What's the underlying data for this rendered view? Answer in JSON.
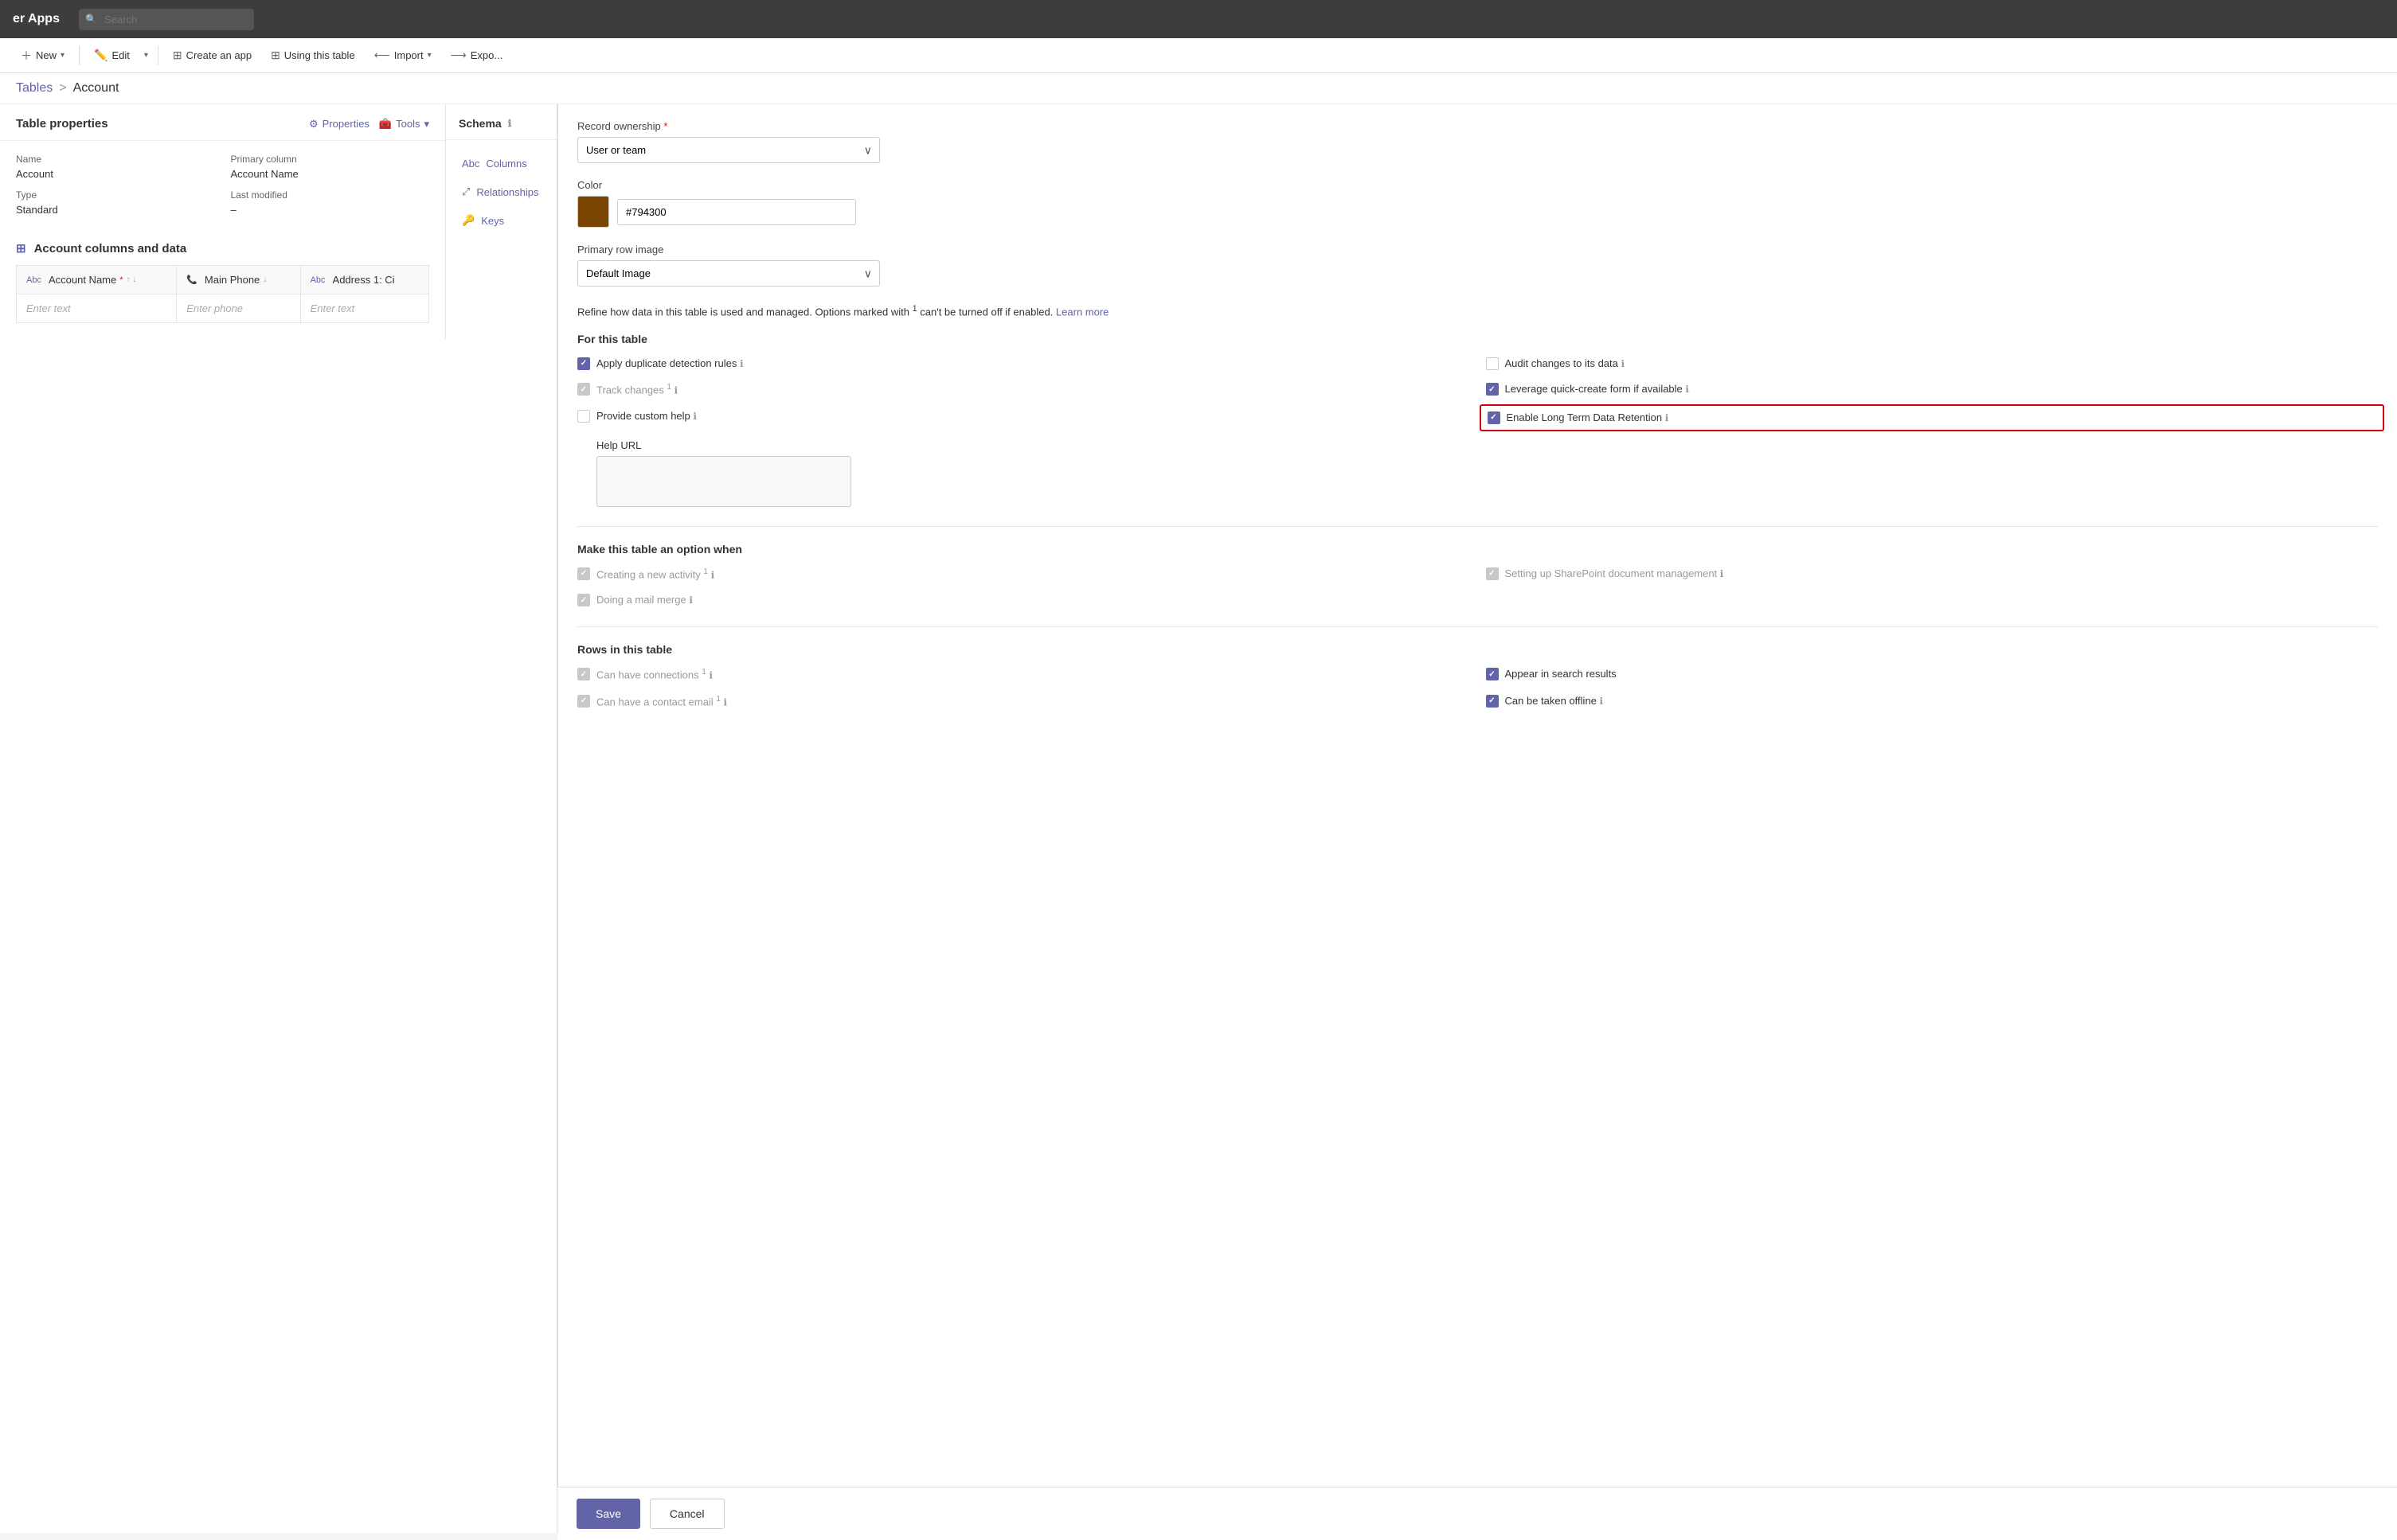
{
  "topbar": {
    "title": "er Apps",
    "search_placeholder": "Search"
  },
  "cmdbar": {
    "new_label": "New",
    "edit_label": "Edit",
    "create_app_label": "Create an app",
    "using_table_label": "Using this table",
    "import_label": "Import",
    "export_label": "Expo..."
  },
  "breadcrumb": {
    "parent": "Tables",
    "separator": ">",
    "current": "Account"
  },
  "table_properties": {
    "section_title": "Table properties",
    "properties_btn": "Properties",
    "tools_btn": "Tools",
    "name_label": "Name",
    "name_value": "Account",
    "primary_col_label": "Primary column",
    "primary_col_value": "Account Name",
    "type_label": "Type",
    "type_value": "Standard",
    "last_modified_label": "Last modified",
    "last_modified_value": "–"
  },
  "schema": {
    "title": "Schema",
    "columns": "Columns",
    "relationships": "Relationships",
    "keys": "Keys"
  },
  "columns_section": {
    "title": "Account columns and data",
    "columns": [
      {
        "label": "Account Name",
        "icon": "Abc",
        "required": true,
        "sort": true
      },
      {
        "label": "Main Phone",
        "icon": "phone"
      },
      {
        "label": "Address 1: Ci",
        "icon": "Abc"
      }
    ],
    "placeholder_text": "Enter text",
    "placeholder_phone": "Enter phone"
  },
  "right_panel": {
    "record_ownership_label": "Record ownership",
    "record_ownership_required": true,
    "record_ownership_value": "User or team",
    "color_label": "Color",
    "color_hex": "#794300",
    "color_swatch": "#794300",
    "primary_row_image_label": "Primary row image",
    "primary_row_image_value": "Default Image",
    "description": "Refine how data in this table is used and managed. Options marked with",
    "description_sup": "1",
    "description_2": "can't be turned off if enabled.",
    "learn_more": "Learn more",
    "for_this_table": {
      "title": "For this table",
      "options": [
        {
          "id": "apply_duplicate",
          "label": "Apply duplicate detection rules",
          "checked": true,
          "disabled": false,
          "info": true
        },
        {
          "id": "audit_changes",
          "label": "Audit changes to its data",
          "checked": false,
          "disabled": false,
          "info": true
        },
        {
          "id": "track_changes",
          "label": "Track changes",
          "checked": false,
          "disabled": true,
          "sup": true,
          "info": true
        },
        {
          "id": "leverage_quick",
          "label": "Leverage quick-create form if available",
          "checked": true,
          "disabled": false,
          "info": true
        },
        {
          "id": "provide_custom_help",
          "label": "Provide custom help",
          "checked": false,
          "disabled": false,
          "info": true
        },
        {
          "id": "enable_long_term",
          "label": "Enable Long Term Data Retention",
          "checked": true,
          "disabled": false,
          "info": true,
          "highlighted": true
        }
      ],
      "help_url_label": "Help URL"
    },
    "make_option": {
      "title": "Make this table an option when",
      "options": [
        {
          "id": "creating_activity",
          "label": "Creating a new activity",
          "checked": true,
          "disabled": true,
          "sup": true,
          "info": true
        },
        {
          "id": "sharepoint_doc",
          "label": "Setting up SharePoint document management",
          "checked": true,
          "disabled": true,
          "info": true
        },
        {
          "id": "doing_mail_merge",
          "label": "Doing a mail merge",
          "checked": true,
          "disabled": true,
          "info": true
        }
      ]
    },
    "rows_in_table": {
      "title": "Rows in this table",
      "options": [
        {
          "id": "can_have_connections",
          "label": "Can have connections",
          "checked": true,
          "disabled": true,
          "sup": true,
          "info": true
        },
        {
          "id": "appear_search",
          "label": "Appear in search results",
          "checked": true,
          "disabled": false,
          "info": false
        },
        {
          "id": "can_have_contact_email",
          "label": "Can have a contact email",
          "checked": true,
          "disabled": true,
          "sup": true,
          "info": true
        },
        {
          "id": "can_be_offline",
          "label": "Can be taken offline",
          "checked": true,
          "disabled": false,
          "info": true
        }
      ]
    },
    "save_label": "Save",
    "cancel_label": "Cancel"
  }
}
